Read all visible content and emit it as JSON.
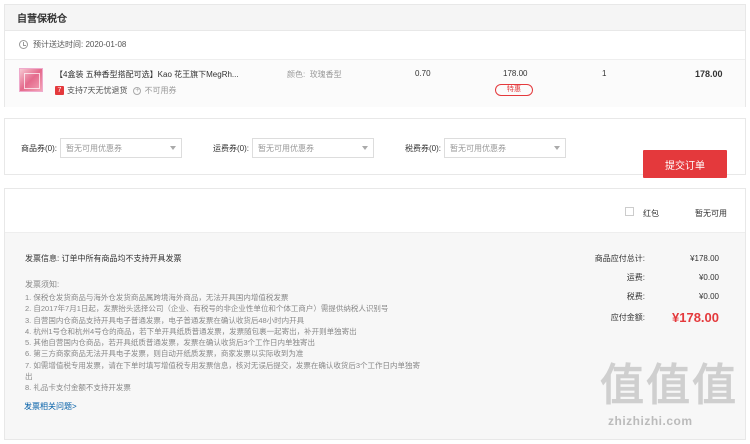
{
  "section_title": "自营保税仓",
  "delivery": {
    "label": "预计送达时间: 2020-01-08"
  },
  "item": {
    "name": "【4盒装 五种香型搭配可选】Kao 花王旗下MegRh...",
    "return_policy": "支持7天无忧退货",
    "return_badge": "7",
    "coupon_status": "不可用券",
    "color_label": "颜色:",
    "color_value": "玫瑰香型",
    "tax": "0.70",
    "price": "178.00",
    "price_tag": "特惠",
    "quantity": "1",
    "subtotal": "178.00"
  },
  "coupons": [
    {
      "label": "商品券(0):",
      "value": "暂无可用优惠券"
    },
    {
      "label": "运费券(0):",
      "value": "暂无可用优惠券"
    },
    {
      "label": "税费券(0):",
      "value": "暂无可用优惠券"
    }
  ],
  "red_packet": {
    "label": "红包",
    "value": "暂无可用"
  },
  "invoice": {
    "info": "发票信息: 订单中所有商品均不支持开具发票",
    "notes_title": "发票须知:",
    "notes": [
      "1. 保税仓发货商品与海外仓发货商品属跨境海外商品，无法开具国内增值税发票",
      "2. 自2017年7月1日起，发票抬头选择公司（企业、有税号的非企业性单位和个体工商户）需提供纳税人识别号",
      "3. 自营国内仓商品支持开具电子普通发票，电子普通发票在确认收货后48小时内开具",
      "4. 杭州1号仓和杭州4号仓的商品，若下单开具纸质普通发票，发票随包裹一起寄出，补开则单独寄出",
      "5. 其他自营国内仓商品，若开具纸质普通发票，发票在确认收货后3个工作日内单独寄出",
      "6. 第三方商家商品无法开具电子发票，则自动开纸质发票，商家发票以实际收到为准",
      "7. 如需增值税专用发票，请在下单时填写增值税专用发票信息，核对无误后提交，发票在确认收货后3个工作日内单独寄",
      "出",
      "8. 礼品卡支付金额不支持开发票"
    ],
    "link": "发票相关问题>"
  },
  "summary": {
    "goods_label": "商品应付总计:",
    "goods_value": "¥178.00",
    "shipping_label": "运费:",
    "shipping_value": "¥0.00",
    "tax_label": "税费:",
    "tax_value": "¥0.00",
    "total_label": "应付金额:",
    "total_value": "¥178.00"
  },
  "submit_label": "提交订单",
  "watermark": {
    "logo": "值值值",
    "url": "zhizhizhi.com"
  },
  "colors": {
    "accent": "#e4393c",
    "link": "#005ea7"
  }
}
